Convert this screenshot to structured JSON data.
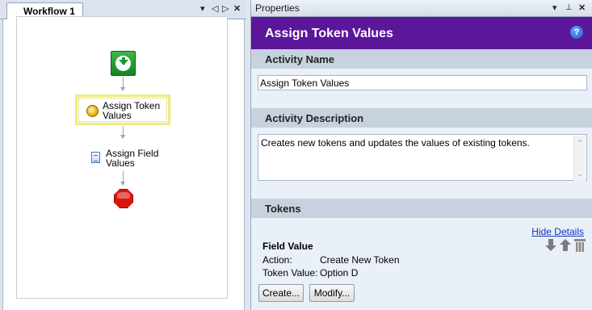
{
  "workflow_tab": {
    "title": "Workflow 1",
    "controls": {
      "dropdown": "▾",
      "prev": "◁",
      "next": "▷",
      "close": "✕"
    }
  },
  "workflow": {
    "nodes": [
      {
        "label": "Assign Token Values",
        "icon": "coin-icon"
      },
      {
        "label": "Assign Field Values",
        "icon": "document-icon"
      }
    ]
  },
  "properties_pane": {
    "title": "Properties",
    "controls": {
      "dropdown": "▾",
      "pin": "📌",
      "close": "✕"
    },
    "header_title": "Assign Token Values",
    "help": "?",
    "accent_color": "#5b169a"
  },
  "activity_name": {
    "section_title": "Activity Name",
    "value": "Assign Token Values"
  },
  "activity_description": {
    "section_title": "Activity Description",
    "value": "Creates new tokens and updates the values of existing tokens."
  },
  "tokens": {
    "section_title": "Tokens",
    "hide_details": "Hide Details",
    "token": {
      "name": "Field Value",
      "action_label": "Action:",
      "action_value": "Create New Token",
      "token_value_label": "Token Value:",
      "token_value": "Option D"
    },
    "create_button": "Create...",
    "modify_button": "Modify..."
  }
}
